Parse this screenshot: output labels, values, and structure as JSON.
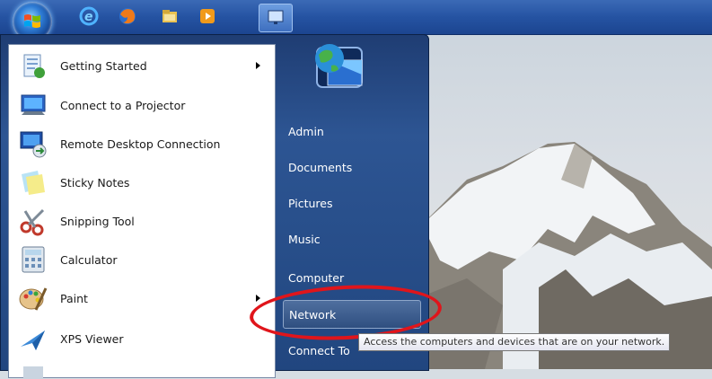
{
  "taskbar": {
    "pinned": [
      {
        "name": "internet-explorer-icon",
        "color": "#3a9be0"
      },
      {
        "name": "firefox-icon",
        "color": "#e86a1a"
      },
      {
        "name": "file-explorer-icon",
        "color": "#e8c65a"
      },
      {
        "name": "media-player-icon",
        "color": "#e8891a"
      },
      {
        "name": "remote-desktop-icon",
        "color": "#9bc4f0"
      }
    ]
  },
  "start_menu": {
    "programs": [
      {
        "label": "Getting Started",
        "icon": "getting-started-icon",
        "has_submenu": true
      },
      {
        "label": "Connect to a Projector",
        "icon": "projector-icon",
        "has_submenu": false
      },
      {
        "label": "Remote Desktop Connection",
        "icon": "remote-desktop-icon",
        "has_submenu": false
      },
      {
        "label": "Sticky Notes",
        "icon": "sticky-notes-icon",
        "has_submenu": false
      },
      {
        "label": "Snipping Tool",
        "icon": "snipping-tool-icon",
        "has_submenu": false
      },
      {
        "label": "Calculator",
        "icon": "calculator-icon",
        "has_submenu": false
      },
      {
        "label": "Paint",
        "icon": "paint-icon",
        "has_submenu": true
      },
      {
        "label": "XPS Viewer",
        "icon": "xps-viewer-icon",
        "has_submenu": false
      }
    ],
    "places": [
      {
        "label": "Admin"
      },
      {
        "label": "Documents"
      },
      {
        "label": "Pictures"
      },
      {
        "label": "Music"
      },
      {
        "label": "Computer"
      },
      {
        "label": "Network"
      },
      {
        "label": "Connect To"
      }
    ],
    "hovered_place": "Network"
  },
  "tooltip": {
    "text": "Access the computers and devices that are on your network."
  },
  "colors": {
    "taskbar": "#2553a2",
    "menu_right": "#2d5593",
    "annotation": "#e0151b"
  }
}
